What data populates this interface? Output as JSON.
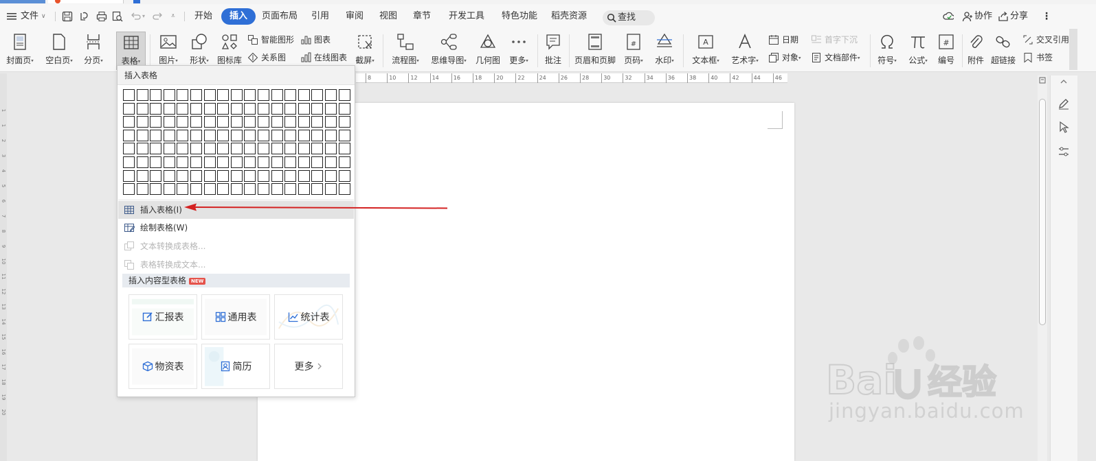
{
  "menubar": {
    "file": "文件",
    "tabs": [
      "开始",
      "插入",
      "页面布局",
      "引用",
      "审阅",
      "视图",
      "章节",
      "开发工具",
      "特色功能",
      "稻壳资源"
    ],
    "active_tab": "插入",
    "search": "查找",
    "collab": "协作",
    "share": "分享"
  },
  "ribbon": {
    "cover": "封面页",
    "blank": "空白页",
    "pagebreak": "分页",
    "table": "表格",
    "picture": "图片",
    "shape": "形状",
    "iconlib": "图标库",
    "smartart": "智能图形",
    "chart": "图表",
    "relation": "关系图",
    "onlinechart": "在线图表",
    "screenshot": "截屏",
    "flowchart": "流程图",
    "mindmap": "思维导图",
    "geometry": "几何图",
    "more": "更多",
    "comment": "批注",
    "header_footer": "页眉和页脚",
    "page_number": "页码",
    "watermark": "水印",
    "textbox": "文本框",
    "wordart": "艺术字",
    "date": "日期",
    "dropcap": "首字下沉",
    "object": "对象",
    "docparts": "文档部件",
    "symbol": "符号",
    "formula": "公式",
    "numbering": "编号",
    "attachment": "附件",
    "hyperlink": "超链接",
    "crossref": "交叉引用",
    "bookmark": "书签"
  },
  "ruler": [
    "8",
    "10",
    "12",
    "14",
    "16",
    "18",
    "20",
    "22",
    "24",
    "26",
    "28",
    "30",
    "32",
    "34",
    "36",
    "38",
    "40",
    "42",
    "44",
    "46"
  ],
  "vruler": [
    "1",
    "1",
    "2",
    "3",
    "4",
    "5",
    "6",
    "7",
    "8",
    "9",
    "10",
    "11",
    "12",
    "13",
    "14",
    "15",
    "16",
    "17",
    "18",
    "19",
    "20"
  ],
  "dropdown": {
    "header": "插入表格",
    "grid": {
      "columns": 17,
      "rows": 8
    },
    "insert_table": "插入表格(I)",
    "draw_table": "绘制表格(W)",
    "text_to_table": "文本转换成表格...",
    "table_to_text": "表格转换成文本...",
    "content_table_section": "插入内容型表格",
    "new_badge": "NEW",
    "templates": {
      "report": "汇报表",
      "general": "通用表",
      "stats": "统计表",
      "inventory": "物资表",
      "resume": "简历",
      "more": "更多"
    }
  },
  "watermark": {
    "site": "jingyan.baidu.com"
  },
  "colors": {
    "accent": "#2f6fd6",
    "arrow": "#d42222",
    "ribbon_bg": "#f7f7f7"
  }
}
